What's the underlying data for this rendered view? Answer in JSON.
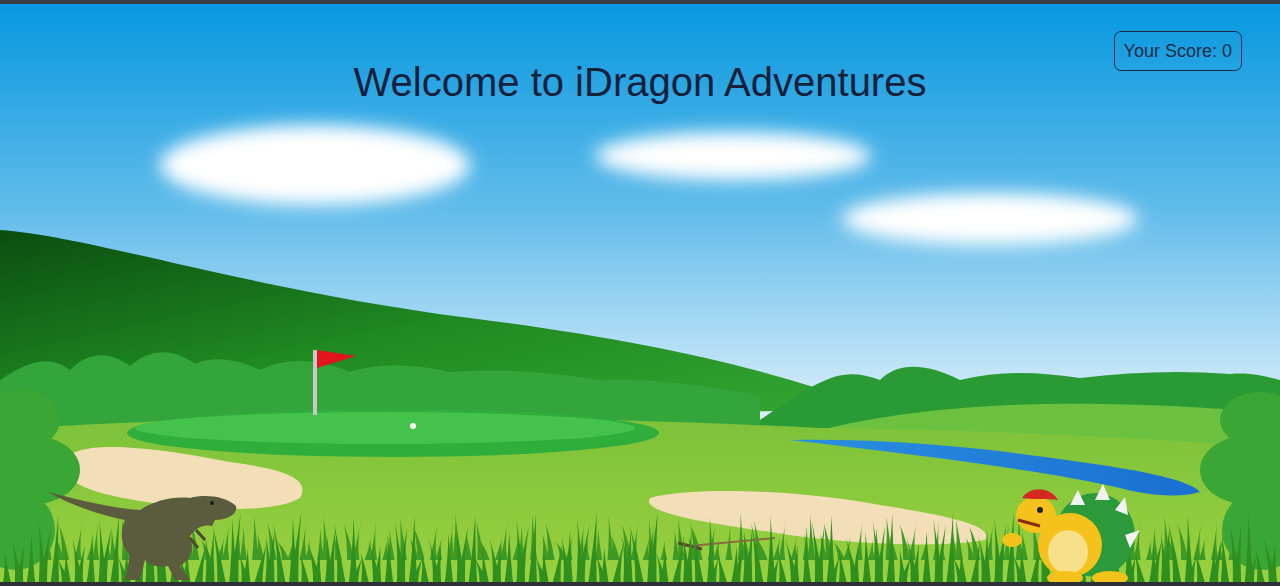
{
  "title": "Welcome to iDragon Adventures",
  "score": {
    "label": "Your Score: 0"
  }
}
